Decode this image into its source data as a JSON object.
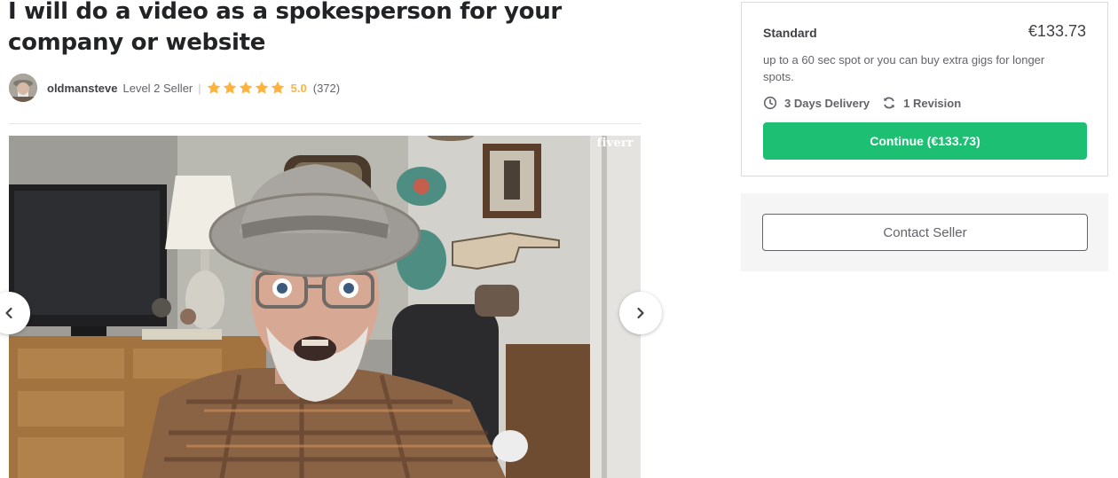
{
  "gig": {
    "title": "I will do a video as a spokesperson for your company or website"
  },
  "seller": {
    "name": "oldmansteve",
    "level": "Level 2 Seller",
    "separator": "|",
    "rating": "5.0",
    "rating_value": 5,
    "review_count": "(372)",
    "avatar_icon": "seller-avatar"
  },
  "gallery": {
    "watermark": "fiverr",
    "prev_icon": "chevron-left-icon",
    "next_icon": "chevron-right-icon"
  },
  "package": {
    "name": "Standard",
    "price": "€133.73",
    "description": "up to a 60 sec spot or you can buy extra gigs for longer spots.",
    "delivery": "3 Days Delivery",
    "revisions": "1 Revision",
    "continue_label": "Continue (€133.73)"
  },
  "contact": {
    "label": "Contact Seller"
  },
  "colors": {
    "accent_green": "#1dbf73",
    "star": "#ffb33e",
    "text_dark": "#222325",
    "text_muted": "#62646a"
  }
}
